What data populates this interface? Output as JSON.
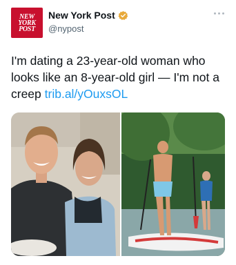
{
  "account": {
    "avatar_text": "NEW\nYORK\nPOST",
    "display_name": "New York Post",
    "handle": "@nypost",
    "verified_color": "#e8a93a"
  },
  "tweet": {
    "text": "I'm dating a 23-year-old woman who looks like an 8-year-old girl — I'm not a creep ",
    "link": "trib.al/yOuxsOL"
  },
  "icons": {
    "more": "more-horizontal-icon",
    "verified": "verified-badge-icon"
  },
  "colors": {
    "brand": "#c8102e",
    "link": "#1d9bf0",
    "secondary_text": "#536471"
  }
}
